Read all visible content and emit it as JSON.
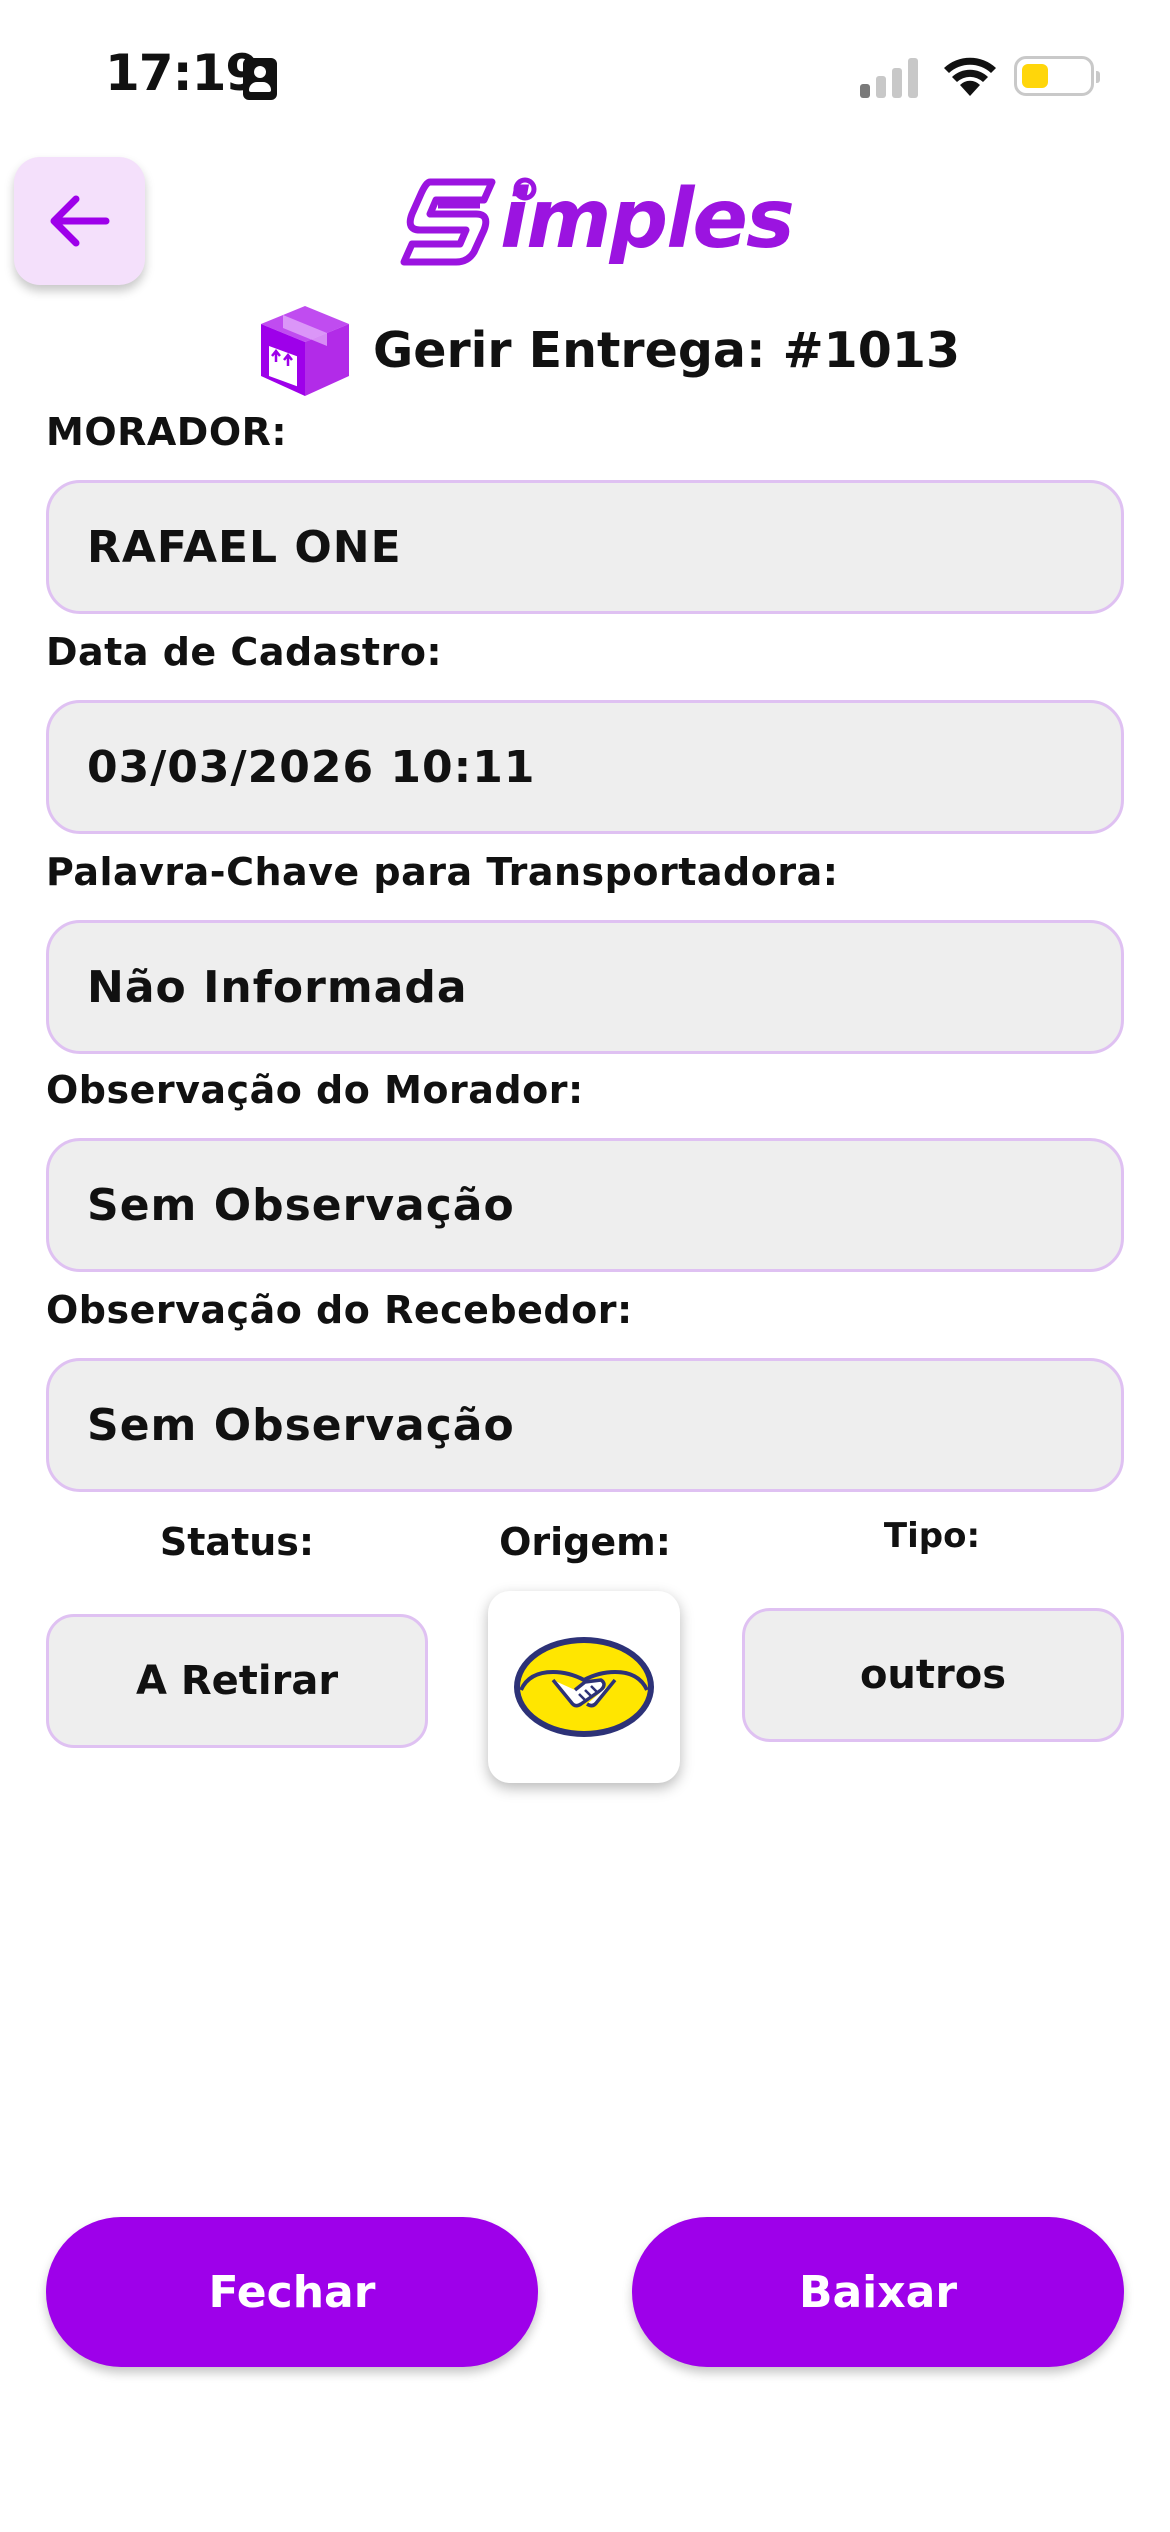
{
  "status_bar": {
    "time": "17:19",
    "battery_color": "#ffd60a"
  },
  "header": {
    "back_icon": "arrow-left-icon",
    "logo_text": "imples",
    "logo_mark": "S",
    "title": "Gerir Entrega: #1013",
    "title_icon": "package-box-icon"
  },
  "fields": [
    {
      "label": "MORADOR:",
      "value": "RAFAEL ONE"
    },
    {
      "label": "Data de Cadastro:",
      "value": "03/03/2026 10:11"
    },
    {
      "label": "Palavra-Chave para Transportadora:",
      "value": "Não Informada"
    },
    {
      "label": "Observação do Morador:",
      "value": "Sem Observação"
    },
    {
      "label": "Observação do Recebedor:",
      "value": "Sem Observação"
    }
  ],
  "info": {
    "status_label": "Status:",
    "status_value": "A Retirar",
    "origin_label": "Origem:",
    "origin_icon": "mercado-livre-handshake-icon",
    "type_label": "Tipo:",
    "type_value": "outros"
  },
  "actions": {
    "close_label": "Fechar",
    "confirm_label": "Baixar"
  },
  "colors": {
    "accent": "#9e00ea",
    "field_border": "#dfc1f2",
    "field_bg": "#eeeeee",
    "back_button_bg": "#f4e0fb"
  }
}
